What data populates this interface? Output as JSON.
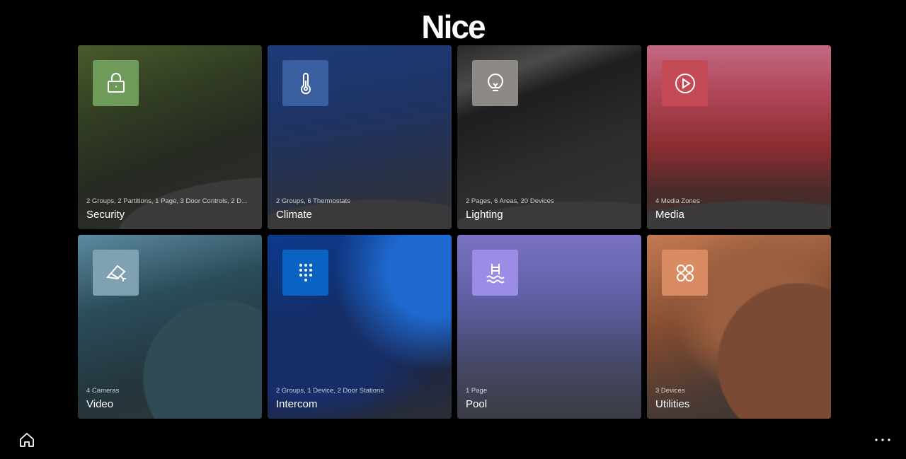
{
  "header": {
    "logo": "Nice"
  },
  "tiles": [
    {
      "title": "Security",
      "subtitle": "2 Groups, 2 Partitions, 1 Page, 3 Door Controls, 2 D...",
      "icon": "lock-icon",
      "icon_color": "#6e9b5a"
    },
    {
      "title": "Climate",
      "subtitle": "2 Groups, 6 Thermostats",
      "icon": "thermometer-icon",
      "icon_color": "#3a5fa0"
    },
    {
      "title": "Lighting",
      "subtitle": "2 Pages, 6 Areas, 20 Devices",
      "icon": "lightbulb-icon",
      "icon_color": "#8d8a86"
    },
    {
      "title": "Media",
      "subtitle": "4 Media Zones",
      "icon": "play-circle-icon",
      "icon_color": "#c44a55"
    },
    {
      "title": "Video",
      "subtitle": "4 Cameras",
      "icon": "camera-icon",
      "icon_color": "#7fa1b2"
    },
    {
      "title": "Intercom",
      "subtitle": "2 Groups, 1 Device, 2 Door Stations",
      "icon": "keypad-icon",
      "icon_color": "#0a63c2"
    },
    {
      "title": "Pool",
      "subtitle": "1 Page",
      "icon": "pool-ladder-icon",
      "icon_color": "#9b8de6"
    },
    {
      "title": "Utilities",
      "subtitle": "3 Devices",
      "icon": "four-circles-icon",
      "icon_color": "#d98c63"
    }
  ],
  "footer": {
    "home_icon": "home-icon",
    "more_icon": "more-horizontal-icon"
  }
}
